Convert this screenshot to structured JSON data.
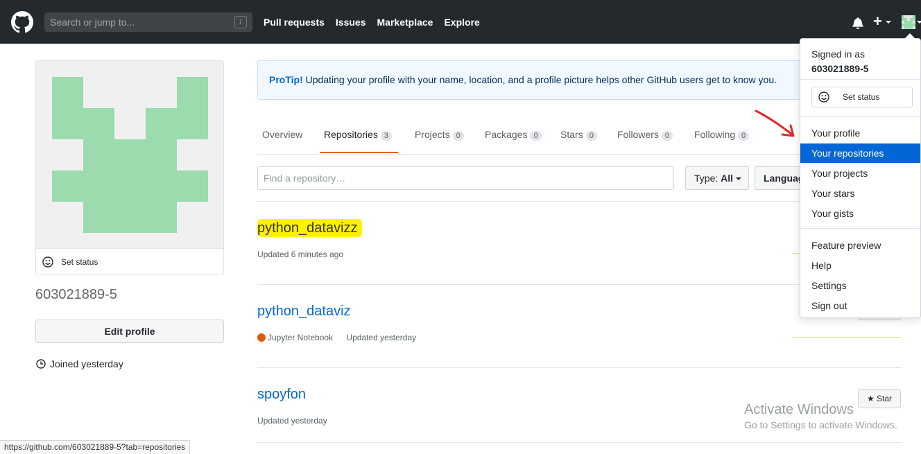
{
  "header": {
    "search_placeholder": "Search or jump to...",
    "search_shortcut": "/",
    "nav": [
      "Pull requests",
      "Issues",
      "Marketplace",
      "Explore"
    ],
    "plus": "+"
  },
  "profile": {
    "set_status": "Set status",
    "username": "603021889-5",
    "edit_profile": "Edit profile",
    "joined": "Joined yesterday"
  },
  "protip": {
    "label": "ProTip!",
    "text": "Updating your profile with your name, location, and a profile picture helps other GitHub users get to know you."
  },
  "tabs": [
    {
      "label": "Overview",
      "count": ""
    },
    {
      "label": "Repositories",
      "count": "3"
    },
    {
      "label": "Projects",
      "count": "0"
    },
    {
      "label": "Packages",
      "count": "0"
    },
    {
      "label": "Stars",
      "count": "0"
    },
    {
      "label": "Followers",
      "count": "0"
    },
    {
      "label": "Following",
      "count": "0"
    }
  ],
  "filter": {
    "find_placeholder": "Find a repository…",
    "type_label": "Type:",
    "type_value": "All",
    "language_label": "Language"
  },
  "repos": [
    {
      "name": "python_datavizz",
      "language": "",
      "updated": "Updated 6 minutes ago"
    },
    {
      "name": "python_dataviz",
      "language": "Jupyter Notebook",
      "updated": "Updated yesterday"
    },
    {
      "name": "spoyfon",
      "language": "",
      "updated": "Updated yesterday"
    }
  ],
  "star_label": "Star",
  "dropdown": {
    "signed_in_as": "Signed in as",
    "user": "603021889-5",
    "set_status": "Set status",
    "group1": [
      "Your profile",
      "Your repositories",
      "Your projects",
      "Your stars",
      "Your gists"
    ],
    "group2": [
      "Feature preview",
      "Help",
      "Settings",
      "Sign out"
    ],
    "active": "Your repositories"
  },
  "watermark": {
    "line1": "Activate Windows",
    "line2": "Go to Settings to activate Windows."
  },
  "status_url": "https://github.com/603021889-5?tab=repositories",
  "colors": {
    "header_bg": "#24292e",
    "link": "#0366d6",
    "highlight": "#fef100",
    "avatar_green": "#9bdbae",
    "tab_underline": "#e36209",
    "arrow_red": "#e3262b"
  }
}
